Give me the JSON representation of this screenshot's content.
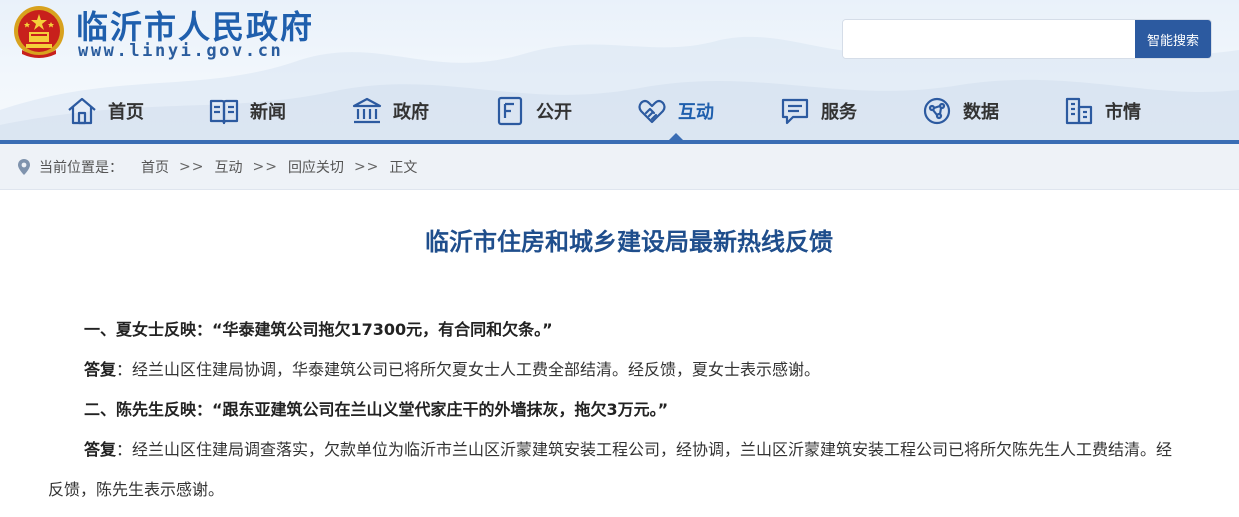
{
  "header": {
    "site_title": "临沂市人民政府",
    "site_url": "www.linyi.gov.cn",
    "search": {
      "placeholder": "",
      "button_label": "智能搜索"
    }
  },
  "nav": {
    "items": [
      {
        "label": "首页",
        "icon": "home-icon",
        "active": false
      },
      {
        "label": "新闻",
        "icon": "news-icon",
        "active": false
      },
      {
        "label": "政府",
        "icon": "government-icon",
        "active": false
      },
      {
        "label": "公开",
        "icon": "disclosure-icon",
        "active": false
      },
      {
        "label": "互动",
        "icon": "handshake-icon",
        "active": true
      },
      {
        "label": "服务",
        "icon": "service-icon",
        "active": false
      },
      {
        "label": "数据",
        "icon": "data-icon",
        "active": false
      },
      {
        "label": "市情",
        "icon": "city-icon",
        "active": false
      }
    ]
  },
  "breadcrumb": {
    "prefix": "当前位置是：",
    "items": [
      "首页",
      "互动",
      "回应关切",
      "正文"
    ],
    "separator": ">>"
  },
  "article": {
    "title": "临沂市住房和城乡建设局最新热线反馈",
    "paragraphs": [
      {
        "bold": "一、夏女士反映：“华泰建筑公司拖欠17300元，有合同和欠条。”",
        "text": ""
      },
      {
        "bold": "答复",
        "text": "：经兰山区住建局协调，华泰建筑公司已将所欠夏女士人工费全部结清。经反馈，夏女士表示感谢。"
      },
      {
        "bold": "二、陈先生反映：“跟东亚建筑公司在兰山义堂代家庄干的外墙抹灰，拖欠3万元。”",
        "text": ""
      },
      {
        "bold": "答复",
        "text": "：经兰山区住建局调查落实，欠款单位为临沂市兰山区沂蒙建筑安装工程公司，经协调，兰山区沂蒙建筑安装工程公司已将所欠陈先生人工费结清。经反馈，陈先生表示感谢。"
      }
    ]
  },
  "colors": {
    "brand_blue": "#1f5fad",
    "nav_bar": "#3a6db4",
    "search_button": "#2c5aa0",
    "breadcrumb_bg": "#eef2f7",
    "title_blue": "#1f4e8c"
  }
}
